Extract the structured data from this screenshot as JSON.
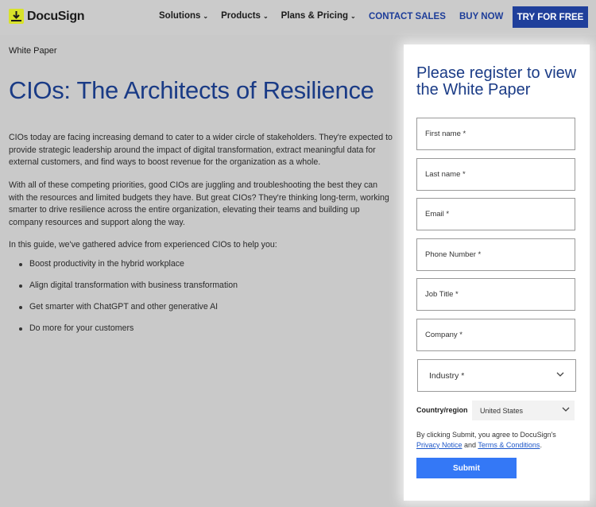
{
  "header": {
    "logo_text": "DocuSign",
    "nav": [
      {
        "label": "Solutions"
      },
      {
        "label": "Products"
      },
      {
        "label": "Plans & Pricing"
      }
    ],
    "contact_sales": "CONTACT SALES",
    "buy_now": "BUY NOW",
    "try_free": "TRY FOR FREE"
  },
  "content": {
    "eyebrow": "White Paper",
    "title": "CIOs: The Architects of Resilience",
    "p1": "CIOs today are facing increasing demand to cater to a wider circle of stakeholders. They're expected to provide strategic leadership around the impact of digital transformation, extract meaningful data for external customers, and find ways to boost revenue for the organization as a whole.",
    "p2": "With all of these competing priorities, good CIOs are juggling and troubleshooting the best they can with the resources and limited budgets they have. But great CIOs? They're thinking long-term, working smarter to drive resilience across the entire organization, elevating their teams and building up company resources and support along the way.",
    "p3": "In this guide, we've gathered advice from experienced CIOs to help you:",
    "bullets": [
      "Boost productivity in the hybrid workplace",
      "Align digital transformation with business transformation",
      "Get smarter with ChatGPT and other generative AI",
      "Do more for your customers"
    ]
  },
  "form": {
    "title": "Please register to view the White Paper",
    "first_name_placeholder": "First name *",
    "last_name_placeholder": "Last name *",
    "email_placeholder": "Email *",
    "phone_placeholder": "Phone Number *",
    "job_title_placeholder": "Job Title *",
    "company_placeholder": "Company *",
    "industry_label": "Industry *",
    "country_label": "Country/region",
    "country_value": "United States",
    "legal_prefix": "By clicking Submit, you agree to DocuSign's",
    "privacy_link": "Privacy Notice",
    "legal_and": "and",
    "terms_link": "Terms & Conditions",
    "legal_suffix": ".",
    "submit_label": "Submit"
  },
  "colors": {
    "brand_blue": "#1a3b86",
    "button_blue": "#3478f6",
    "logo_yellow": "#d8e22a"
  }
}
